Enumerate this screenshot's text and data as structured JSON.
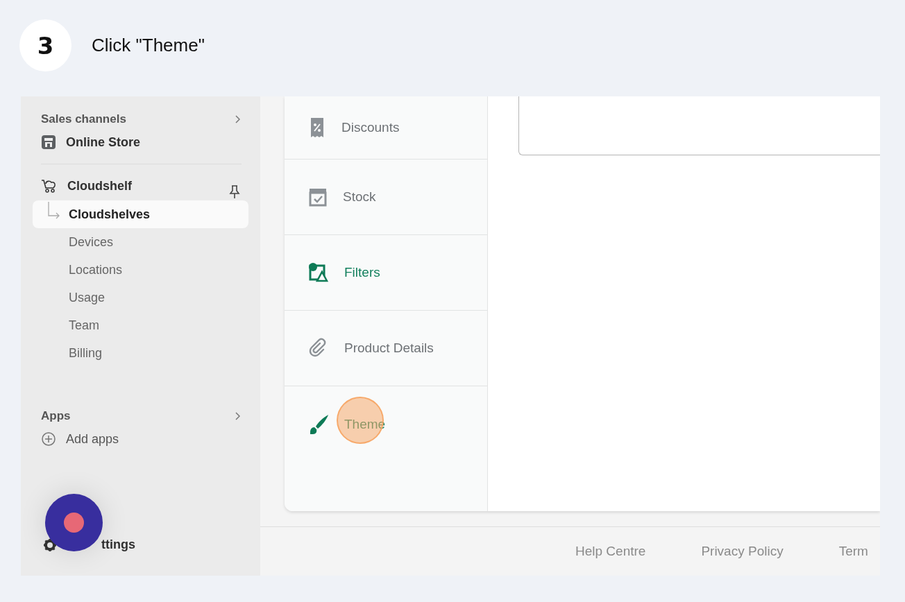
{
  "step": {
    "number": "3",
    "instruction": "Click \"Theme\""
  },
  "sidebar": {
    "sales_channels": {
      "heading": "Sales channels",
      "items": [
        {
          "label": "Online Store"
        }
      ]
    },
    "app": {
      "label": "Cloudshelf",
      "children": [
        {
          "label": "Cloudshelves",
          "selected": true
        },
        {
          "label": "Devices",
          "selected": false
        },
        {
          "label": "Locations",
          "selected": false
        },
        {
          "label": "Usage",
          "selected": false
        },
        {
          "label": "Team",
          "selected": false
        },
        {
          "label": "Billing",
          "selected": false
        }
      ]
    },
    "apps": {
      "heading": "Apps",
      "items": [
        {
          "label": "Add apps"
        }
      ]
    },
    "settings": {
      "label": "ttings"
    }
  },
  "settings_nav": [
    {
      "label": "Discounts",
      "kind": "discount",
      "active": false
    },
    {
      "label": "Stock",
      "kind": "stock",
      "active": false
    },
    {
      "label": "Filters",
      "kind": "filters",
      "active": true
    },
    {
      "label": "Product Details",
      "kind": "clip",
      "active": false
    },
    {
      "label": "Theme",
      "kind": "brush",
      "active": true
    }
  ],
  "footer": {
    "links": [
      "Help Centre",
      "Privacy Policy",
      "Term"
    ]
  }
}
